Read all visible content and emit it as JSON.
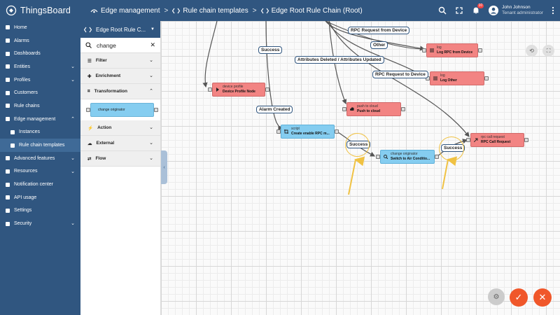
{
  "app": {
    "brand": "ThingsBoard"
  },
  "breadcrumb": {
    "items": [
      "Edge management",
      "Rule chain templates",
      "Edge Root Rule Chain (Root)"
    ],
    "separator": ">"
  },
  "header": {
    "notifications_count": "10",
    "user_name": "John Johnson",
    "user_role": "Tenant administrator"
  },
  "sidebar": {
    "items": [
      {
        "label": "Home",
        "icon": "home-icon"
      },
      {
        "label": "Alarms",
        "icon": "alarm-icon"
      },
      {
        "label": "Dashboards",
        "icon": "dashboard-icon"
      },
      {
        "label": "Entities",
        "icon": "entities-icon",
        "chevron": "down"
      },
      {
        "label": "Profiles",
        "icon": "profiles-icon",
        "chevron": "down"
      },
      {
        "label": "Customers",
        "icon": "customers-icon"
      },
      {
        "label": "Rule chains",
        "icon": "rule-chains-icon"
      },
      {
        "label": "Edge management",
        "icon": "edge-icon",
        "chevron": "up"
      },
      {
        "label": "Instances",
        "icon": "instances-icon",
        "sub": true
      },
      {
        "label": "Rule chain templates",
        "icon": "rule-chain-templates-icon",
        "sub": true,
        "active": true
      },
      {
        "label": "Advanced features",
        "icon": "advanced-icon",
        "chevron": "down"
      },
      {
        "label": "Resources",
        "icon": "resources-icon",
        "chevron": "down"
      },
      {
        "label": "Notification center",
        "icon": "notification-icon"
      },
      {
        "label": "API usage",
        "icon": "api-usage-icon"
      },
      {
        "label": "Settings",
        "icon": "settings-icon"
      },
      {
        "label": "Security",
        "icon": "security-icon",
        "chevron": "down"
      }
    ]
  },
  "rule_panel": {
    "chain_select": "Edge Root Rule C...",
    "search_value": "change",
    "sections": {
      "filter": "Filter",
      "enrichment": "Enrichment",
      "transformation": "Transformation",
      "action": "Action",
      "external": "External",
      "flow": "Flow"
    },
    "library_node": "change originator"
  },
  "nodes": {
    "device_profile": {
      "type": "device profile",
      "name": "Device Profile Node"
    },
    "log_rpc": {
      "type": "log",
      "name": "Log RPC from Device"
    },
    "log_other": {
      "type": "log",
      "name": "Log Other"
    },
    "push_cloud": {
      "type": "push to cloud",
      "name": "Push to cloud"
    },
    "script": {
      "type": "script",
      "name": "Create enable RPC m..."
    },
    "change_orig": {
      "type": "change originator",
      "name": "Switch to Air Conditio..."
    },
    "rpc_call": {
      "type": "rpc call request",
      "name": "RPC Call Request"
    }
  },
  "edge_labels": {
    "rpc_from_device": "RPC Request from Device",
    "other": "Other",
    "success_top": "Success",
    "attrs": "Attributes Deleted / Attributes Updated",
    "rpc_to_device": "RPC Request to Device",
    "alarm_created": "Alarm Created",
    "success_script": "Success",
    "success_change": "Success"
  },
  "colors": {
    "primary": "#305680",
    "action_node": "#f28483",
    "transformation_node": "#85cdf0",
    "highlight_ring": "#f0c243",
    "fab": "#f0572a"
  }
}
